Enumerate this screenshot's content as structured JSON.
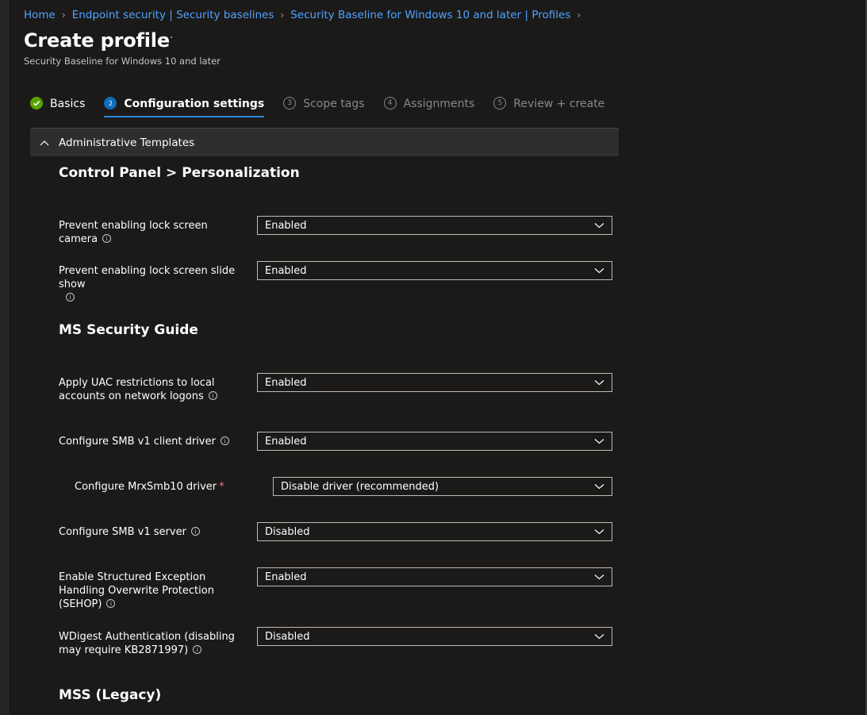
{
  "breadcrumb": {
    "items": [
      "Home",
      "Endpoint security | Security baselines",
      "Security Baseline for Windows 10 and later | Profiles"
    ]
  },
  "header": {
    "title": "Create profile",
    "more": "···",
    "subtitle": "Security Baseline for Windows 10 and later"
  },
  "wizard": {
    "steps": [
      {
        "num": "",
        "label": "Basics",
        "state": "done"
      },
      {
        "num": "2",
        "label": "Configuration settings",
        "state": "active"
      },
      {
        "num": "3",
        "label": "Scope tags",
        "state": "pending"
      },
      {
        "num": "4",
        "label": "Assignments",
        "state": "pending"
      },
      {
        "num": "5",
        "label": "Review + create",
        "state": "pending"
      }
    ]
  },
  "section": {
    "title": "Administrative Templates"
  },
  "groups": [
    {
      "heading": "Control Panel > Personalization"
    },
    {
      "heading": "MS Security Guide"
    },
    {
      "heading": "MSS (Legacy)"
    }
  ],
  "settings": [
    {
      "label": "Prevent enabling lock screen camera",
      "value": "Enabled"
    },
    {
      "label": "Prevent enabling lock screen slide show",
      "value": "Enabled"
    },
    {
      "label": "Apply UAC restrictions to local accounts on network logons",
      "value": "Enabled"
    },
    {
      "label": "Configure SMB v1 client driver",
      "value": "Enabled"
    },
    {
      "label": "Configure MrxSmb10 driver",
      "required": "*",
      "value": "Disable driver (recommended)"
    },
    {
      "label": "Configure SMB v1 server",
      "value": "Disabled"
    },
    {
      "label": "Enable Structured Exception Handling Overwrite Protection (SEHOP)",
      "value": "Enabled"
    },
    {
      "label": "WDigest Authentication (disabling may require KB2871997)",
      "value": "Disabled"
    }
  ],
  "icons": {
    "info": "info-icon",
    "chevron_down": "chevron-down-icon",
    "chevron_up": "chevron-up-icon",
    "check": "checkmark-icon",
    "breadcrumb_sep": "chevron-right-icon"
  },
  "colors": {
    "background": "#1b1a19",
    "link": "#4fa3ff",
    "success": "#57a300",
    "active_step": "#0f6cbd",
    "required": "#f1707b"
  }
}
